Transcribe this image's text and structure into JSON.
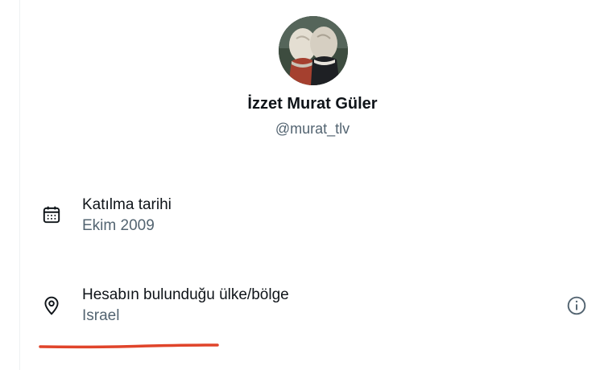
{
  "profile": {
    "display_name": "İzzet Murat Güler",
    "handle": "@murat_tlv"
  },
  "details": [
    {
      "label": "Katılma tarihi",
      "value": "Ekim 2009",
      "icon": "calendar-icon"
    },
    {
      "label": "Hesabın bulunduğu ülke/bölge",
      "value": "Israel",
      "icon": "location-pin-icon",
      "action_icon": "info-icon"
    }
  ],
  "colors": {
    "text_primary": "#0f1419",
    "text_secondary": "#536471",
    "highlight": "#e0442a"
  }
}
